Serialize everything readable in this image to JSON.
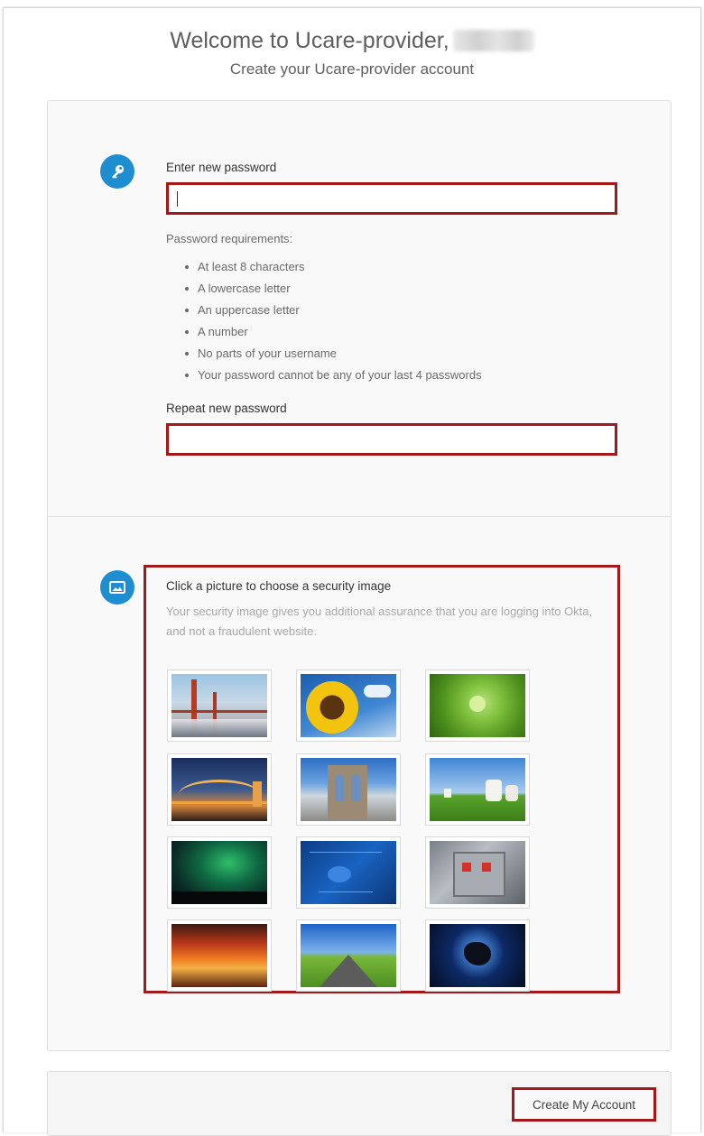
{
  "header": {
    "welcome_text": "Welcome to Ucare-provider,",
    "subtitle": "Create your Ucare-provider account"
  },
  "password_section": {
    "icon": "key-icon",
    "new_password_label": "Enter new password",
    "new_password_value": "",
    "requirements_title": "Password requirements:",
    "requirements": [
      "At least 8 characters",
      "A lowercase letter",
      "An uppercase letter",
      "A number",
      "No parts of your username",
      "Your password cannot be any of your last 4 passwords"
    ],
    "repeat_password_label": "Repeat new password",
    "repeat_password_value": ""
  },
  "security_image_section": {
    "icon": "image-icon",
    "title": "Click a picture to choose a security image",
    "description": "Your security image gives you additional assurance that you are logging into Okta, and not a fraudulent website.",
    "images": [
      {
        "name": "golden-gate-bridge"
      },
      {
        "name": "sunflower"
      },
      {
        "name": "green-succulent"
      },
      {
        "name": "harbour-bridge-night"
      },
      {
        "name": "brooklyn-bridge"
      },
      {
        "name": "goats-on-hill"
      },
      {
        "name": "northern-lights"
      },
      {
        "name": "circuit-board"
      },
      {
        "name": "robot-toy"
      },
      {
        "name": "sunset-clouds"
      },
      {
        "name": "open-road"
      },
      {
        "name": "eclipse"
      }
    ]
  },
  "footer": {
    "create_button_label": "Create My Account"
  },
  "colors": {
    "accent_blue": "#1f8ed1",
    "highlight_red": "#a31818",
    "card_bg": "#f9f9f9"
  }
}
